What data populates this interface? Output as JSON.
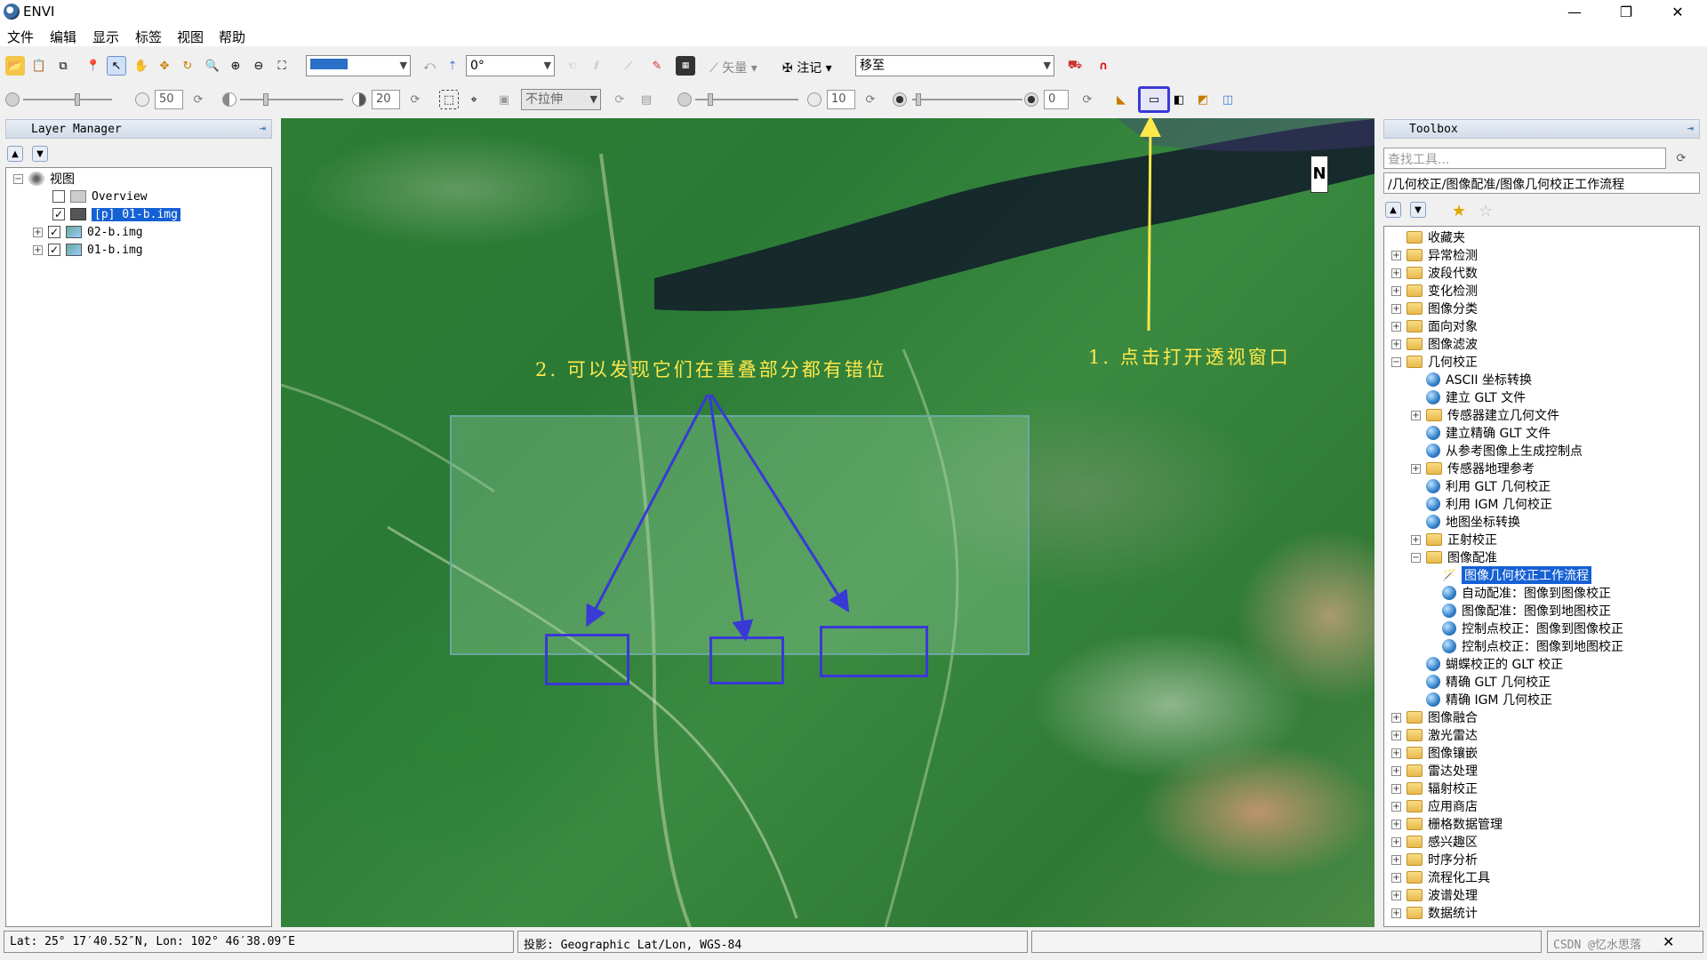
{
  "window": {
    "title": "ENVI",
    "minimize": "—",
    "maximize": "❐",
    "close": "✕"
  },
  "menu": [
    "文件",
    "编辑",
    "显示",
    "标签",
    "视图",
    "帮助"
  ],
  "toolbar1": {
    "rotation_value": "0°",
    "vector_label": "矢量",
    "annotation_label": "注记",
    "goto_value": "移至"
  },
  "toolbar2": {
    "brightness_value": "50",
    "contrast_value": "20",
    "stretch_value": "不拉伸",
    "sharpen_value": "10",
    "transparency_value": "0"
  },
  "layer_manager": {
    "title": "Layer Manager",
    "root": "视图",
    "items": [
      {
        "label": "Overview",
        "checked": false
      },
      {
        "label": "[p] 01-b.img",
        "checked": true,
        "selected": true
      },
      {
        "label": "02-b.img",
        "checked": true
      },
      {
        "label": "01-b.img",
        "checked": true
      }
    ]
  },
  "toolbox": {
    "title": "Toolbox",
    "search_placeholder": "查找工具...",
    "path": "/几何校正/图像配准/图像几何校正工作流程",
    "tree": [
      {
        "label": "收藏夹",
        "level": 0,
        "type": "folder",
        "expander": ""
      },
      {
        "label": "异常检测",
        "level": 0,
        "type": "folder",
        "expander": "+"
      },
      {
        "label": "波段代数",
        "level": 0,
        "type": "folder",
        "expander": "+"
      },
      {
        "label": "变化检测",
        "level": 0,
        "type": "folder",
        "expander": "+"
      },
      {
        "label": "图像分类",
        "level": 0,
        "type": "folder",
        "expander": "+"
      },
      {
        "label": "面向对象",
        "level": 0,
        "type": "folder",
        "expander": "+"
      },
      {
        "label": "图像滤波",
        "level": 0,
        "type": "folder",
        "expander": "+"
      },
      {
        "label": "几何校正",
        "level": 0,
        "type": "folder",
        "expander": "−"
      },
      {
        "label": "ASCII 坐标转换",
        "level": 1,
        "type": "tool",
        "expander": ""
      },
      {
        "label": "建立 GLT 文件",
        "level": 1,
        "type": "tool",
        "expander": ""
      },
      {
        "label": "传感器建立几何文件",
        "level": 1,
        "type": "folder",
        "expander": "+"
      },
      {
        "label": "建立精确 GLT 文件",
        "level": 1,
        "type": "tool",
        "expander": ""
      },
      {
        "label": "从参考图像上生成控制点",
        "level": 1,
        "type": "tool",
        "expander": ""
      },
      {
        "label": "传感器地理参考",
        "level": 1,
        "type": "folder",
        "expander": "+"
      },
      {
        "label": "利用 GLT 几何校正",
        "level": 1,
        "type": "tool",
        "expander": ""
      },
      {
        "label": "利用 IGM 几何校正",
        "level": 1,
        "type": "tool",
        "expander": ""
      },
      {
        "label": "地图坐标转换",
        "level": 1,
        "type": "tool",
        "expander": ""
      },
      {
        "label": "正射校正",
        "level": 1,
        "type": "folder",
        "expander": "+"
      },
      {
        "label": "图像配准",
        "level": 1,
        "type": "folder",
        "expander": "−"
      },
      {
        "label": "图像几何校正工作流程",
        "level": 2,
        "type": "wand",
        "expander": "",
        "selected": true
      },
      {
        "label": "自动配准：图像到图像校正",
        "level": 2,
        "type": "tool",
        "expander": ""
      },
      {
        "label": "图像配准：图像到地图校正",
        "level": 2,
        "type": "tool",
        "expander": ""
      },
      {
        "label": "控制点校正：图像到图像校正",
        "level": 2,
        "type": "tool",
        "expander": ""
      },
      {
        "label": "控制点校正：图像到地图校正",
        "level": 2,
        "type": "tool",
        "expander": ""
      },
      {
        "label": "蝴蝶校正的 GLT 校正",
        "level": 1,
        "type": "tool",
        "expander": ""
      },
      {
        "label": "精确 GLT 几何校正",
        "level": 1,
        "type": "tool",
        "expander": ""
      },
      {
        "label": "精确 IGM 几何校正",
        "level": 1,
        "type": "tool",
        "expander": ""
      },
      {
        "label": "图像融合",
        "level": 0,
        "type": "folder",
        "expander": "+"
      },
      {
        "label": "激光雷达",
        "level": 0,
        "type": "folder",
        "expander": "+"
      },
      {
        "label": "图像镶嵌",
        "level": 0,
        "type": "folder",
        "expander": "+"
      },
      {
        "label": "雷达处理",
        "level": 0,
        "type": "folder",
        "expander": "+"
      },
      {
        "label": "辐射校正",
        "level": 0,
        "type": "folder",
        "expander": "+"
      },
      {
        "label": "应用商店",
        "level": 0,
        "type": "folder",
        "expander": "+"
      },
      {
        "label": "栅格数据管理",
        "level": 0,
        "type": "folder",
        "expander": "+"
      },
      {
        "label": "感兴趣区",
        "level": 0,
        "type": "folder",
        "expander": "+"
      },
      {
        "label": "时序分析",
        "level": 0,
        "type": "folder",
        "expander": "+"
      },
      {
        "label": "流程化工具",
        "level": 0,
        "type": "folder",
        "expander": "+"
      },
      {
        "label": "波谱处理",
        "level": 0,
        "type": "folder",
        "expander": "+"
      },
      {
        "label": "数据统计",
        "level": 0,
        "type": "folder",
        "expander": "+"
      }
    ]
  },
  "map": {
    "north_label": "N"
  },
  "annotations": {
    "step1": "1. 点击打开透视窗口",
    "step2": "2. 可以发现它们在重叠部分都有错位"
  },
  "status": {
    "coords": "Lat: 25° 17′40.52″N, Lon: 102° 46′38.09″E",
    "projection": "投影: Geographic Lat/Lon, WGS-84",
    "watermark": "CSDN @忆水思落",
    "close": "✕"
  },
  "colors": {
    "annotation_yellow": "#ffe84a",
    "annotation_blue": "#3939d6",
    "selection": "#1560d4"
  }
}
